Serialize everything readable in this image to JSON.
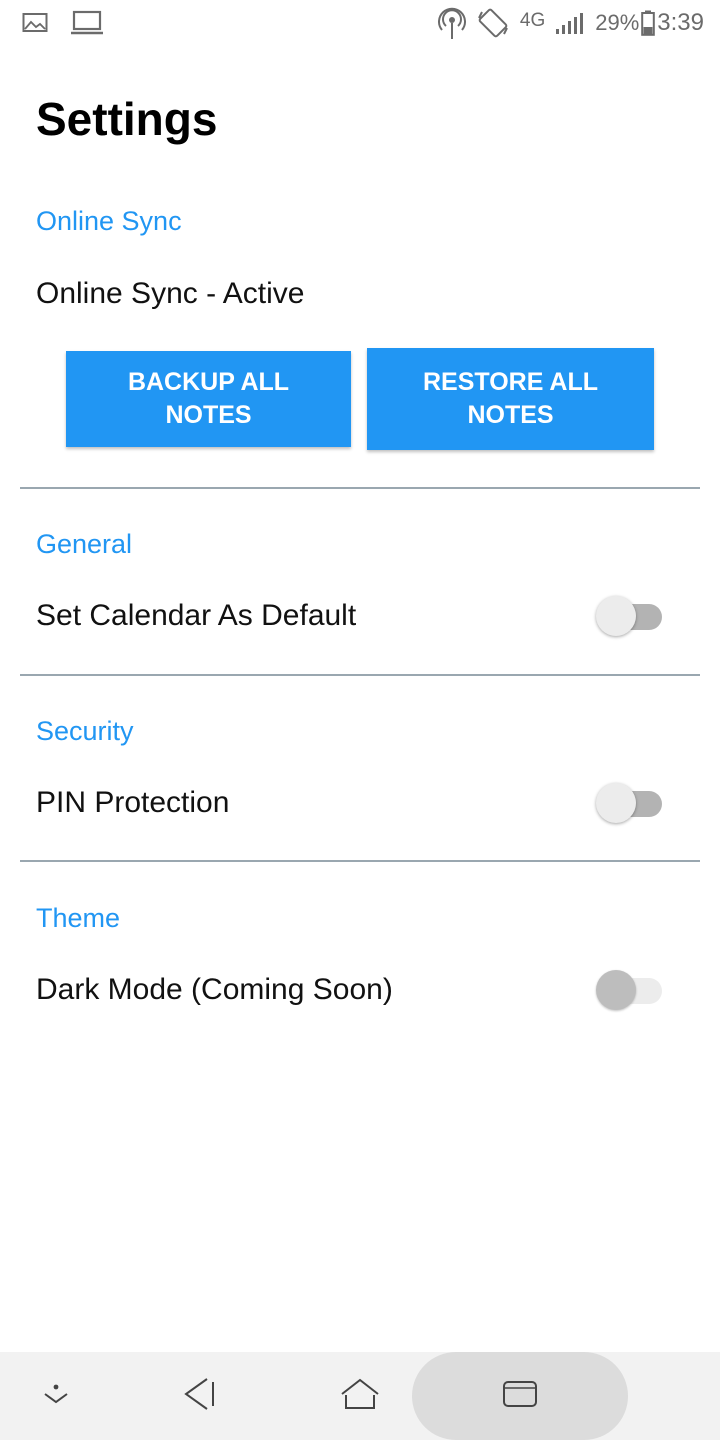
{
  "status_bar": {
    "left_icons": [
      "image-icon",
      "laptop-icon"
    ],
    "right_icons": [
      "hotspot-icon",
      "rotate-icon",
      "signal-icon",
      "battery-icon"
    ],
    "network": "4G",
    "battery": "29%",
    "time": "3:39"
  },
  "page": {
    "title": "Settings"
  },
  "sections": {
    "online_sync": {
      "header": "Online Sync",
      "status": "Online Sync - Active",
      "backup_label": "BACKUP ALL NOTES",
      "restore_label": "RESTORE ALL NOTES"
    },
    "general": {
      "header": "General",
      "calendar_label": "Set Calendar As Default",
      "calendar_enabled": false
    },
    "security": {
      "header": "Security",
      "pin_label": "PIN Protection",
      "pin_enabled": false
    },
    "theme": {
      "header": "Theme",
      "dark_label": "Dark Mode (Coming Soon)",
      "dark_enabled": false,
      "dark_disabled": true
    }
  },
  "nav_bar": {
    "icons": [
      "hide-keyboard-icon",
      "back-icon",
      "home-icon",
      "recents-icon"
    ]
  },
  "colors": {
    "accent": "#2196f3",
    "divider": "#9aa7b0",
    "nav_background": "#f2f2f2"
  }
}
